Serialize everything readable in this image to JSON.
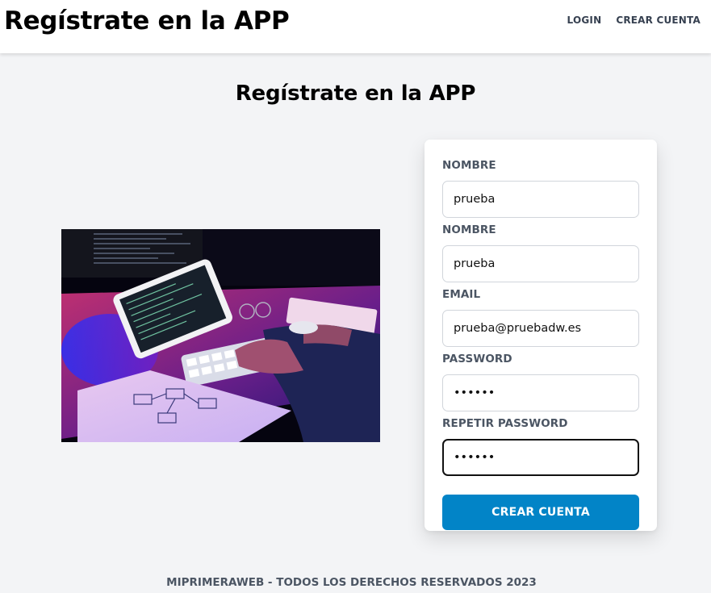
{
  "header": {
    "brand": "Regístrate en la APP",
    "nav": [
      {
        "label": "LOGIN"
      },
      {
        "label": "CREAR CUENTA"
      }
    ]
  },
  "page": {
    "title": "Regístrate en la APP"
  },
  "hero_image": {
    "description_icon": "photo-developer-coding-icon"
  },
  "form": {
    "fields": [
      {
        "label": "NOMBRE",
        "value": "prueba",
        "type": "text"
      },
      {
        "label": "NOMBRE",
        "value": "prueba",
        "type": "text"
      },
      {
        "label": "EMAIL",
        "value": "prueba@pruebadw.es",
        "type": "email"
      },
      {
        "label": "PASSWORD",
        "value": "123456",
        "type": "password"
      },
      {
        "label": "REPETIR PASSWORD",
        "value": "123456",
        "type": "password"
      }
    ],
    "submit_label": "CREAR CUENTA"
  },
  "footer": {
    "text": "MIPRIMERAWEB - TODOS LOS DERECHOS RESERVADOS 2023"
  },
  "colors": {
    "accent": "#0284c7",
    "background": "#f3f4f6"
  }
}
